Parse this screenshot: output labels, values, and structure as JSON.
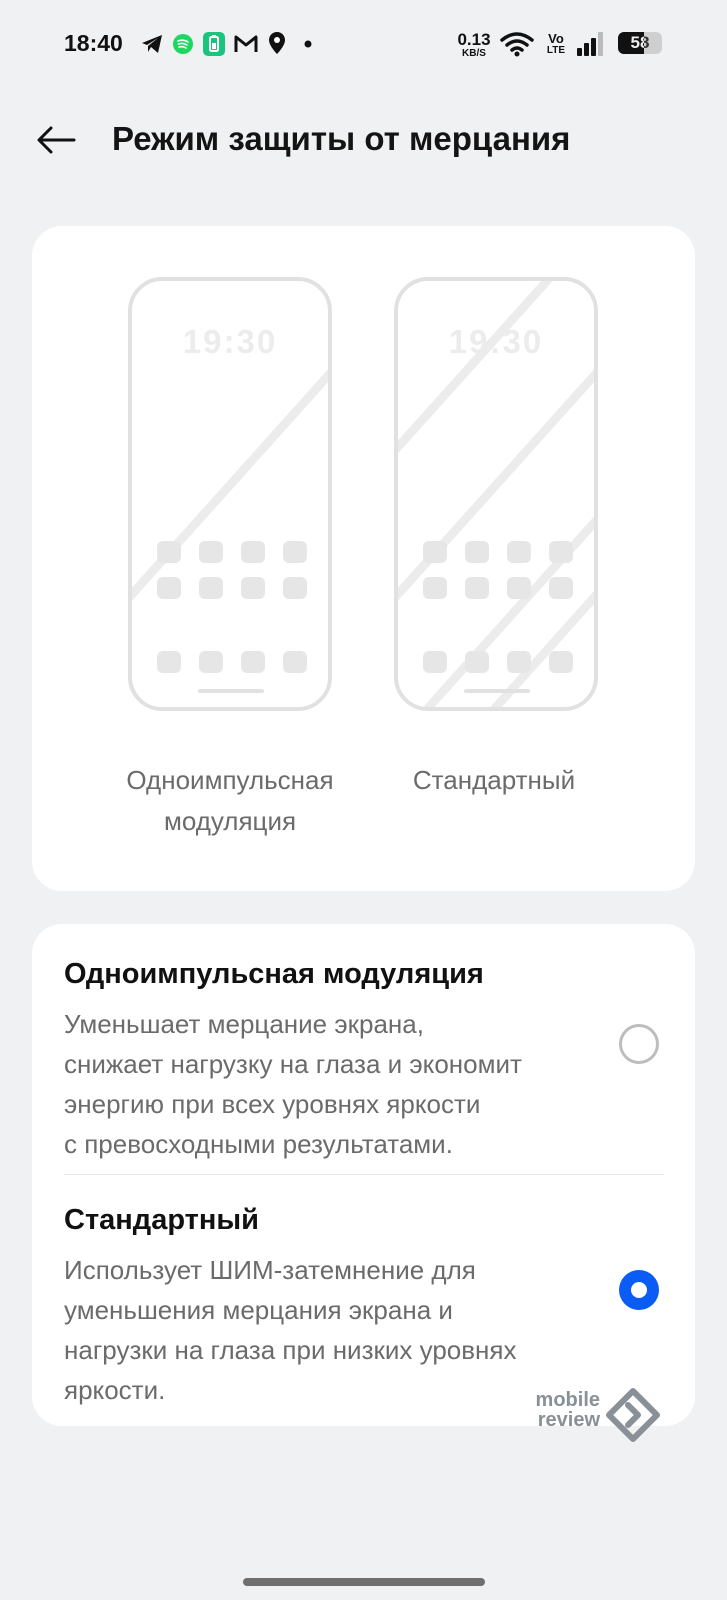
{
  "status_bar": {
    "time": "18:40",
    "icons": [
      "telegram-icon",
      "spotify-icon",
      "battery-saver-icon",
      "gmail-icon",
      "location-icon",
      "dot-icon",
      "wifi-icon",
      "volte-icon",
      "signal-icon",
      "battery-icon"
    ],
    "net_speed_value": "0.13",
    "net_speed_unit": "KB/S",
    "volte_top": "Vo",
    "volte_bottom": "LTE",
    "battery_level": "58"
  },
  "header": {
    "title": "Режим защиты от мерцания",
    "back_icon": "arrow-left-icon"
  },
  "preview": {
    "phone_a_clock": "19:30",
    "phone_b_clock": "19:30",
    "label_a": "Одноимпульсная\nмодуляция",
    "label_b": "Стандартный"
  },
  "options": [
    {
      "title": "Одноимпульсная модуляция",
      "description": "Уменьшает мерцание экрана,\nснижает нагрузку на глаза и экономит\nэнергию при всех уровнях яркости\nс превосходными результатами.",
      "selected": false
    },
    {
      "title": "Стандартный",
      "description": "Использует ШИМ-затемнение для\nуменьшения мерцания экрана и\nнагрузки на глаза при низких уровнях\nяркости.",
      "selected": true
    }
  ],
  "watermark": {
    "text": "mobile\nreview"
  },
  "colors": {
    "accent": "#0a5cf5",
    "background": "#f0f1f3",
    "card": "#ffffff"
  }
}
